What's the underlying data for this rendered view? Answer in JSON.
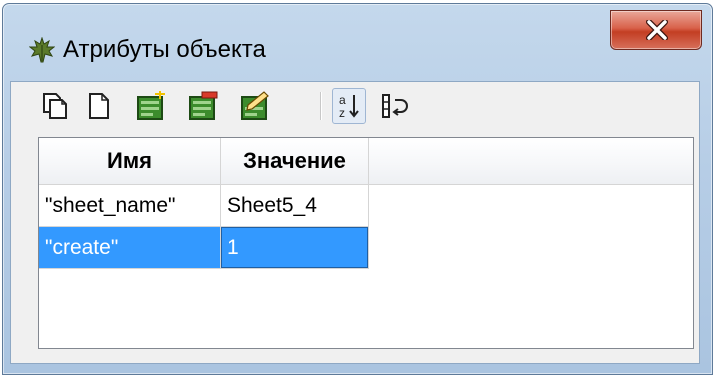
{
  "window": {
    "title": "Атрибуты объекта",
    "title_icon": "maple-leaf-icon",
    "close_glyph": "X"
  },
  "toolbar": {
    "buttons": [
      {
        "icon": "copy-icon",
        "pressed": false
      },
      {
        "icon": "new-document-icon",
        "pressed": false
      },
      {
        "icon": "add-attribute-icon",
        "pressed": false
      },
      {
        "icon": "delete-attribute-icon",
        "pressed": false
      },
      {
        "icon": "edit-attribute-icon",
        "pressed": false
      },
      {
        "icon": "sort-az-icon",
        "pressed": true
      },
      {
        "icon": "restore-order-icon",
        "pressed": false
      }
    ]
  },
  "table": {
    "columns": [
      "Имя",
      "Значение"
    ],
    "rows": [
      {
        "name": "\"sheet_name\"",
        "value": "Sheet5_4",
        "selected": false
      },
      {
        "name": "\"create\"",
        "value": "1",
        "selected": true
      }
    ]
  },
  "colors": {
    "selection": "#3399ff",
    "titlebar": "#b6cde6",
    "close_button": "#c33e23"
  }
}
